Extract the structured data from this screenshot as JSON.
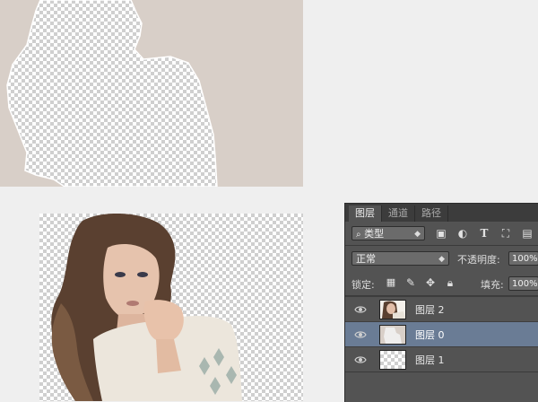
{
  "layers_panel": {
    "tabs": [
      {
        "label": "图层",
        "active": true
      },
      {
        "label": "通道",
        "active": false
      },
      {
        "label": "路径",
        "active": false
      }
    ],
    "filter": {
      "icon": "search-icon",
      "label": "类型"
    },
    "filter_icons": [
      "image-filter-icon",
      "adjustment-filter-icon",
      "text-filter-icon",
      "shape-filter-icon",
      "smart-object-filter-icon"
    ],
    "blend_mode": "正常",
    "opacity_label": "不透明度:",
    "opacity_value": "100%",
    "lock_label": "锁定:",
    "lock_icons": [
      "lock-transparent-icon",
      "lock-paint-icon",
      "lock-position-icon",
      "lock-all-icon"
    ],
    "fill_label": "填充:",
    "fill_value": "100%",
    "layers": [
      {
        "name": "图层 2",
        "visible": true,
        "selected": false,
        "thumbnail": "portrait"
      },
      {
        "name": "图层 0",
        "visible": true,
        "selected": true,
        "thumbnail": "background-color"
      },
      {
        "name": "图层 1",
        "visible": true,
        "selected": false,
        "thumbnail": "transparent"
      }
    ]
  },
  "colors": {
    "panel_bg": "#535353",
    "selected_layer": "#6a7c95",
    "photo_background": "#d8cfc8"
  }
}
